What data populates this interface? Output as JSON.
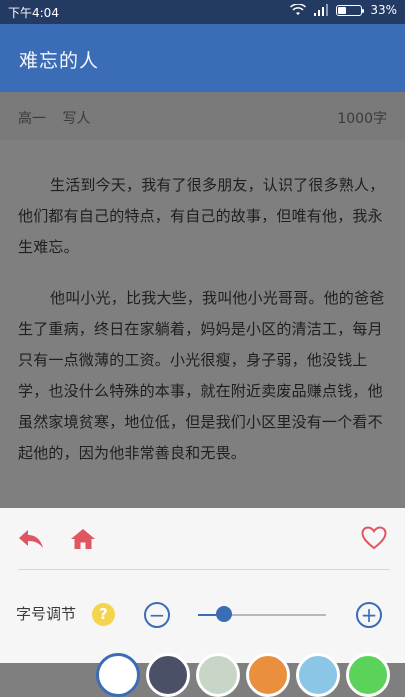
{
  "status_bar": {
    "time": "下午4:04",
    "battery": "33%",
    "battery_level": 0.33
  },
  "header": {
    "title": "难忘的人"
  },
  "meta": {
    "grade": "高一",
    "genre": "写人",
    "word_count": "1000字"
  },
  "article": {
    "paragraphs": [
      "生活到今天，我有了很多朋友，认识了很多熟人，他们都有自己的特点，有自己的故事，但唯有他，我永生难忘。",
      "他叫小光，比我大些，我叫他小光哥哥。他的爸爸生了重病，终日在家躺着，妈妈是小区的清洁工，每月只有一点微薄的工资。小光很瘦，身子弱，他没钱上学，也没什么特殊的本事，就在附近卖废品赚点钱，他虽然家境贫寒，地位低，但是我们小区里没有一个看不起他的，因为他非常善良和无畏。"
    ]
  },
  "panel": {
    "font_size_label": "字号调节",
    "help": "?",
    "minus": "−",
    "plus": "+",
    "slider_value": 0.2,
    "theme_colors": [
      "#ffffff",
      "#4a5066",
      "#c7d6c7",
      "#e98f3e",
      "#8cc6e6",
      "#5bd35b"
    ]
  },
  "colors": {
    "accent": "#3b6cb6",
    "icon_red": "#e05660",
    "status_bar": "#233a63"
  }
}
